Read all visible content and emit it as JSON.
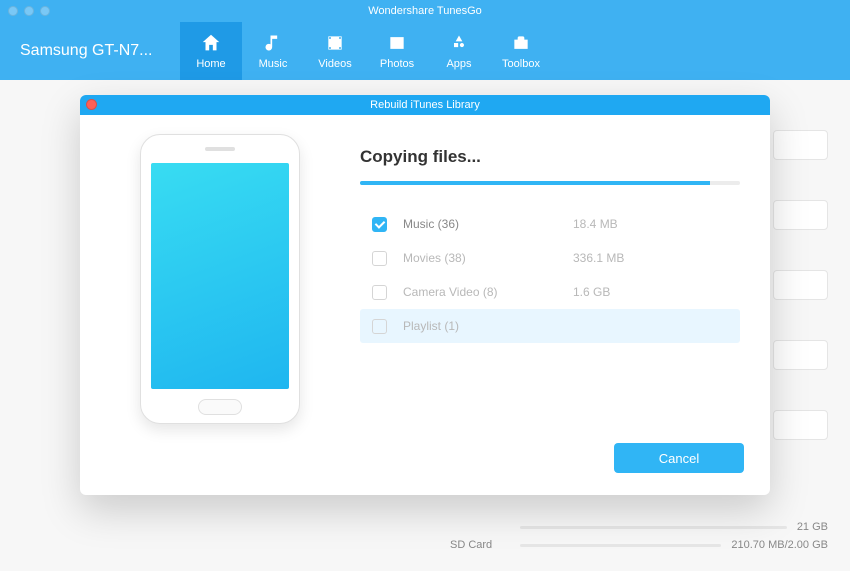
{
  "app_title": "Wondershare TunesGo",
  "device_name": "Samsung GT-N7...",
  "nav": [
    {
      "label": "Home",
      "icon": "home",
      "active": true
    },
    {
      "label": "Music",
      "icon": "music",
      "active": false
    },
    {
      "label": "Videos",
      "icon": "videos",
      "active": false
    },
    {
      "label": "Photos",
      "icon": "photos",
      "active": false
    },
    {
      "label": "Apps",
      "icon": "apps",
      "active": false
    },
    {
      "label": "Toolbox",
      "icon": "toolbox",
      "active": false
    }
  ],
  "storage": [
    {
      "label": "",
      "value": "21 GB"
    },
    {
      "label": "SD Card",
      "value": "210.70 MB/2.00 GB"
    }
  ],
  "modal": {
    "title": "Rebuild iTunes Library",
    "heading": "Copying files...",
    "progress_percent": 92,
    "rows": [
      {
        "checked": true,
        "name": "Music (36)",
        "size": "18.4 MB",
        "highlight": false,
        "active": true
      },
      {
        "checked": false,
        "name": "Movies (38)",
        "size": "336.1 MB",
        "highlight": false,
        "active": false
      },
      {
        "checked": false,
        "name": "Camera Video (8)",
        "size": "1.6 GB",
        "highlight": false,
        "active": false
      },
      {
        "checked": false,
        "name": "Playlist (1)",
        "size": "",
        "highlight": true,
        "active": false
      }
    ],
    "cancel_label": "Cancel"
  }
}
